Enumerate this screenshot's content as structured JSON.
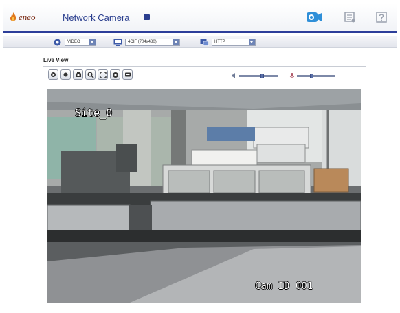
{
  "header": {
    "brand": "eneo",
    "app_title": "Network Camera"
  },
  "toolbar": {
    "stream_select": "VIDEO",
    "resolution_select": "4CIF (704x480)",
    "protocol_select": "HTTP"
  },
  "live_view": {
    "title": "Live View"
  },
  "video": {
    "osd_site": "Site_0",
    "osd_camera": "Cam ID 001"
  },
  "icons": {
    "header": [
      "live-view-camera-icon",
      "setup-icon",
      "help-icon"
    ],
    "controls": [
      "play-icon",
      "stop-icon",
      "snapshot-icon",
      "zoom-icon",
      "fullscreen-icon",
      "audio-icon",
      "record-icon"
    ],
    "sliders": [
      "speaker-icon",
      "microphone-icon"
    ]
  },
  "colors": {
    "brand_blue": "#2b3f8f",
    "header_line": "#2d3e9a"
  }
}
